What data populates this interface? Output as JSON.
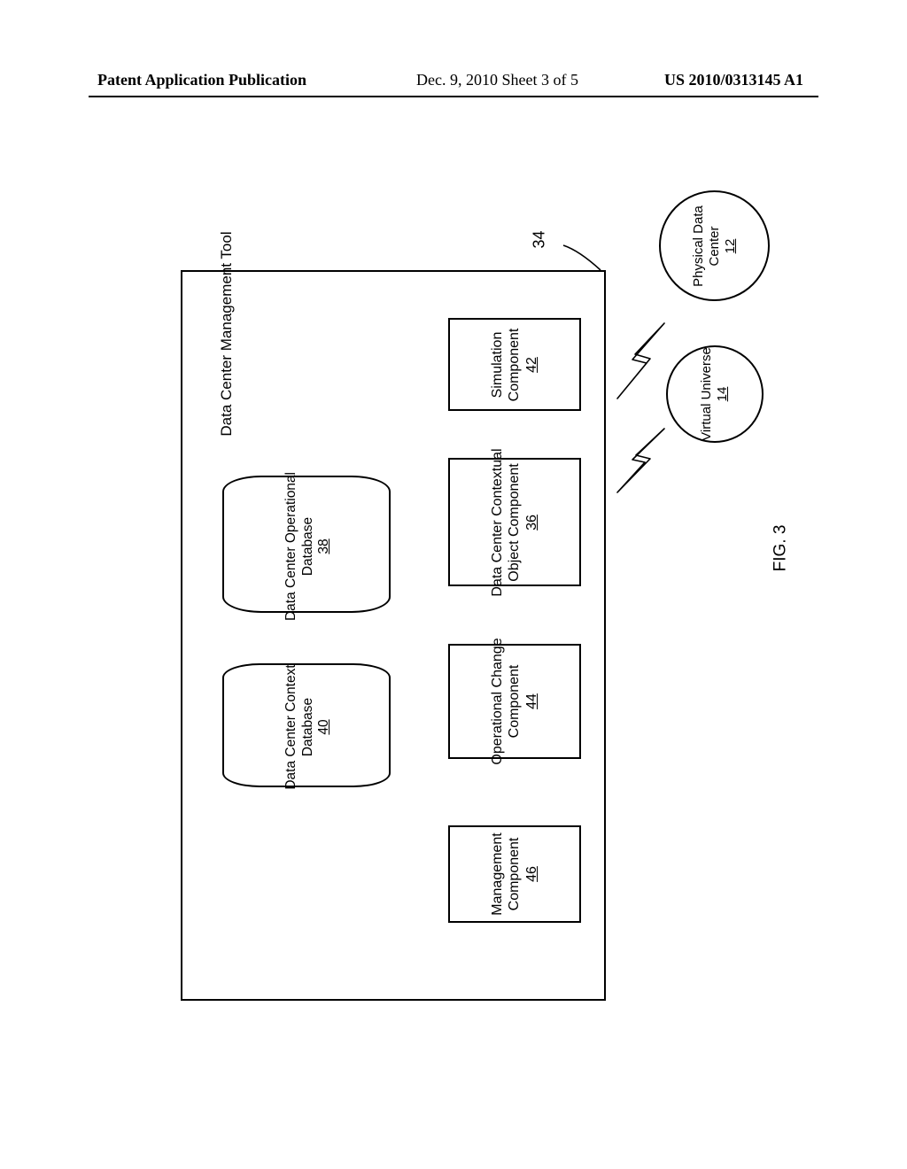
{
  "header": {
    "left": "Patent Application Publication",
    "center": "Dec. 9, 2010  Sheet 3 of 5",
    "right": "US 2010/0313145 A1"
  },
  "figure_label": "FIG. 3",
  "main": {
    "title": "Data Center Management Tool",
    "ref": "34"
  },
  "components": {
    "sim": {
      "label": "Simulation Component",
      "ref": "42"
    },
    "ctx": {
      "label": "Data Center Contextual Object Component",
      "ref": "36"
    },
    "opch": {
      "label": "Operational Change Component",
      "ref": "44"
    },
    "mgmt": {
      "label": "Management Component",
      "ref": "46"
    }
  },
  "databases": {
    "opdb": {
      "label": "Data Center Operational Database",
      "ref": "38"
    },
    "cxdb": {
      "label": "Data Center Context Database",
      "ref": "40"
    }
  },
  "external": {
    "pdc": {
      "label": "Physical Data Center",
      "ref": "12"
    },
    "vu": {
      "label": "Virtual Universe",
      "ref": "14"
    }
  }
}
